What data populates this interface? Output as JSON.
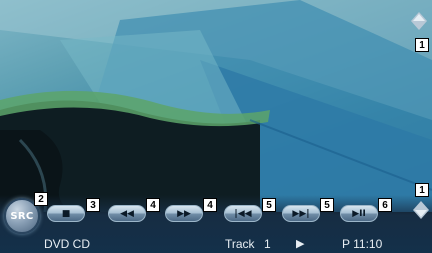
{
  "source_button": {
    "label": "SRC"
  },
  "controls": {
    "stop": {
      "glyph": "■"
    },
    "rewind": {
      "glyph": "◀◀"
    },
    "fast_forward": {
      "glyph": "▶▶"
    },
    "prev": {
      "glyph": "|◀◀"
    },
    "next": {
      "glyph": "▶▶|"
    },
    "play_pause": {
      "glyph": "▶II"
    }
  },
  "status_bar": {
    "media": "DVD CD",
    "track_label": "Track",
    "track_number": "1",
    "play_glyph": "▶",
    "time": "P 11:10"
  },
  "callouts": {
    "scroll_up": "1",
    "scroll_down": "1",
    "src": "2",
    "stop": "3",
    "rew": "4",
    "ff": "4",
    "prev": "5",
    "next": "5",
    "play": "6"
  },
  "icons": {
    "scroll_up": "up-arrow-icon",
    "scroll_down": "down-arrow-icon"
  },
  "colors": {
    "button_top": "#d7e5ef",
    "button_bottom": "#4d6a86",
    "status_text": "#e8eef3"
  }
}
